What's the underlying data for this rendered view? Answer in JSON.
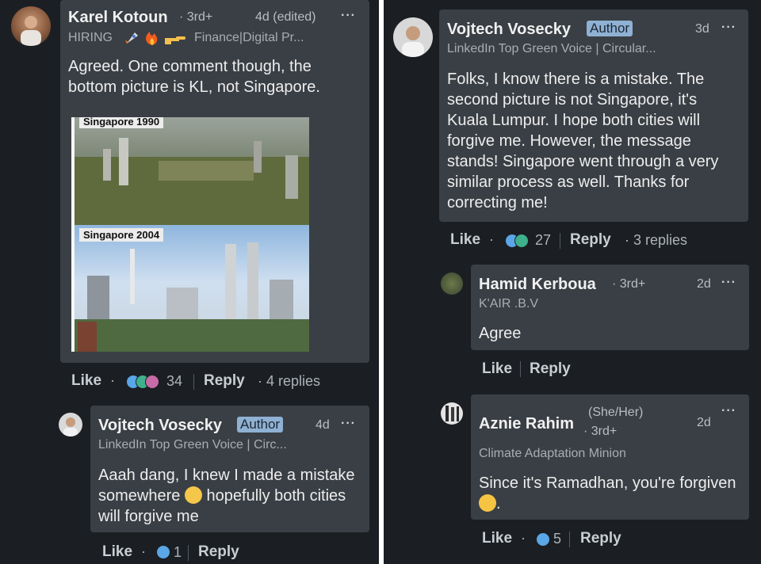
{
  "left": {
    "comment1": {
      "author": "Karel Kotoun",
      "degree": "· 3rd+",
      "time": "4d (edited)",
      "more": "···",
      "headline_hiring": "HIRING",
      "headline_rest": "Finance|Digital Pr...",
      "text": "Agreed. One comment though, the bottom picture is KL, not Singapore.",
      "image_top_label": "Singapore 1990",
      "image_bottom_label": "Singapore 2004",
      "actions": {
        "like": "Like",
        "dot": "·",
        "reactions": "34",
        "reply": "Reply",
        "replies": "· 4 replies"
      }
    },
    "reply1": {
      "author": "Vojtech Vosecky",
      "badge": "Author",
      "time": "4d",
      "more": "···",
      "headline": "LinkedIn Top Green Voice | Circ...",
      "text_before": "Aaah dang, I knew I made a mistake somewhere",
      "text_after": "hopefully both cities will forgive me",
      "actions": {
        "like": "Like",
        "dot": "·",
        "reactions": "1",
        "reply": "Reply"
      }
    }
  },
  "right": {
    "comment1": {
      "author": "Vojtech Vosecky",
      "badge": "Author",
      "time": "3d",
      "more": "···",
      "headline": "LinkedIn Top Green Voice | Circular...",
      "text": "Folks, I know there is a mistake. The second picture is not Singapore, it's Kuala Lumpur. I hope both cities will forgive me. However, the message stands!  Singapore went through a very similar process as well. Thanks for correcting me!",
      "actions": {
        "like": "Like",
        "dot": "·",
        "reactions": "27",
        "reply": "Reply",
        "replies": "· 3 replies"
      }
    },
    "reply1": {
      "author": "Hamid Kerboua",
      "degree": "· 3rd+",
      "time": "2d",
      "more": "···",
      "headline": "K'AIR .B.V",
      "text": "Agree",
      "actions": {
        "like": "Like",
        "reply": "Reply"
      }
    },
    "reply2": {
      "author": "Aznie Rahim",
      "pronouns": "(She/Her)",
      "degree": "· 3rd+",
      "time": "2d",
      "more": "···",
      "headline": "Climate Adaptation Minion",
      "text_before": "Since it's Ramadhan, you're forgiven",
      "text_after": ".",
      "actions": {
        "like": "Like",
        "dot": "·",
        "reactions": "5",
        "reply": "Reply"
      }
    }
  }
}
